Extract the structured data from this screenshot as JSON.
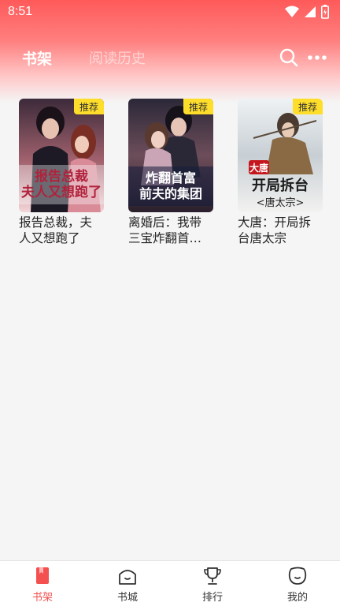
{
  "status": {
    "time": "8:51"
  },
  "tabs": [
    {
      "label": "书架",
      "active": true
    },
    {
      "label": "阅读历史",
      "active": false
    }
  ],
  "icons": {
    "search": "search-icon",
    "more": "more-icon"
  },
  "books": [
    {
      "title": "报告总裁，夫人又想跑了",
      "badge": "推荐",
      "cover_text": "报告总裁 夫人又想跑了"
    },
    {
      "title": "离婚后：我带三宝炸翻首富前夫的集团",
      "badge": "推荐",
      "cover_text": "炸翻首富 前夫的集团"
    },
    {
      "title": "大唐：开局拆台唐太宗",
      "badge": "推荐",
      "cover_text": "开局拆台 唐太宗"
    }
  ],
  "nav": [
    {
      "label": "书架",
      "icon": "bookshelf-icon",
      "active": true
    },
    {
      "label": "书城",
      "icon": "bookstore-icon",
      "active": false
    },
    {
      "label": "排行",
      "icon": "trophy-icon",
      "active": false
    },
    {
      "label": "我的",
      "icon": "profile-icon",
      "active": false
    }
  ],
  "colors": {
    "accent": "#f45050",
    "badge": "#ffde2b",
    "header_top": "#ff5a5a"
  }
}
